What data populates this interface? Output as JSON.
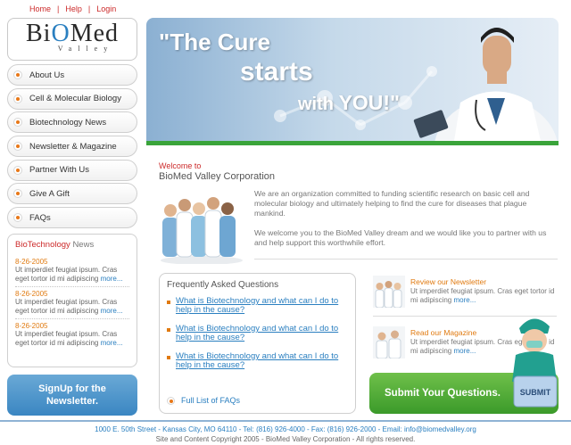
{
  "top_links": [
    "Home",
    "Help",
    "Login"
  ],
  "logo": {
    "text_bio": "Bi",
    "text_o": "O",
    "text_med": "Med",
    "sub": "Valley"
  },
  "nav": [
    "About Us",
    "Cell & Molecular Biology",
    "Biotechnology News",
    "Newsletter & Magazine",
    "Partner With Us",
    "Give A Gift",
    "FAQs"
  ],
  "news": {
    "title_a": "BioTechnology",
    "title_b": "News",
    "items": [
      {
        "date": "8-26-2005",
        "text": "Ut imperdiet feugiat ipsum. Cras eget tortor id mi adipiscing",
        "more": "more..."
      },
      {
        "date": "8-26-2005",
        "text": "Ut imperdiet feugiat ipsum. Cras eget tortor id mi adipiscing",
        "more": "more..."
      },
      {
        "date": "8-26-2005",
        "text": "Ut imperdiet feugiat ipsum. Cras eget tortor id mi adipiscing",
        "more": "more..."
      }
    ]
  },
  "signup": {
    "line1": "SignUp for the",
    "line2": "Newsletter."
  },
  "banner": {
    "line1": "\"The Cure",
    "line2": "starts",
    "line3_a": "with",
    "line3_b": "YOU!\""
  },
  "welcome": {
    "label": "Welcome to",
    "title": "BioMed Valley Corporation"
  },
  "intro": {
    "p1": "We are an organization committed to funding scientific research on basic cell and molecular biology and ultimately helping to find the cure for diseases that plague mankind.",
    "p2": "We welcome you to the BioMed Valley dream and we would like you to partner with us and help support this worthwhile effort."
  },
  "faq": {
    "title": "Frequently Asked Questions",
    "items": [
      "What is Biotechnology and what can I do to help in the cause?",
      "What is Biotechnology and what can I do to help in the cause?",
      "What is Biotechnology and what can I do to help in the cause?"
    ],
    "full": "Full List of FAQs"
  },
  "side": {
    "newsletter": {
      "title": "Review our Newsletter",
      "text": "Ut imperdiet feugiat ipsum. Cras eget tortor id mi adipiscing",
      "more": "more..."
    },
    "magazine": {
      "title": "Read our Magazine",
      "text": "Ut imperdiet feugiat ipsum. Cras eget tortor id mi adipiscing",
      "more": "more..."
    }
  },
  "submit": {
    "label": "Submit Your Questions.",
    "key_label": "SUBMIT"
  },
  "footer": {
    "line1": "1000 E. 50th Street - Kansas City, MO 64110 - Tel: (816) 926-4000 - Fax: (816) 926-2000 - Email: info@biomedvalley.org",
    "line2": "Site and Content Copyright 2005 - BioMed Valley Corporation - All rights reserved."
  },
  "colors": {
    "accent_red": "#cc2a2a",
    "accent_orange": "#e07a10",
    "link_blue": "#2a7fc0",
    "green": "#3b9a2a",
    "blue_button": "#3a86c2"
  }
}
